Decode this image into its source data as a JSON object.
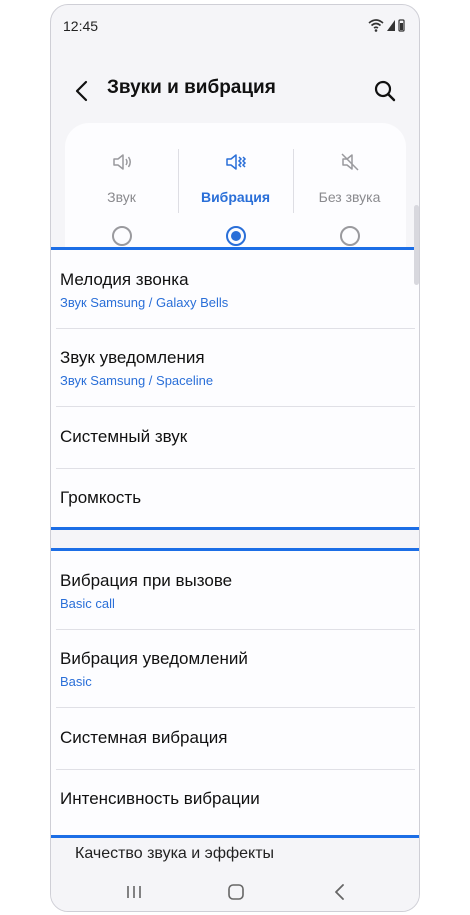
{
  "status_bar": {
    "time": "12:45"
  },
  "header": {
    "title": "Звуки и вибрация"
  },
  "sound_modes": [
    {
      "label": "Звук",
      "icon": "speaker-icon",
      "selected": false
    },
    {
      "label": "Вибрация",
      "icon": "vibrate-icon",
      "selected": true
    },
    {
      "label": "Без звука",
      "icon": "mute-icon",
      "selected": false
    }
  ],
  "sound_group": [
    {
      "title": "Мелодия звонка",
      "subtitle": "Звук Samsung / Galaxy Bells"
    },
    {
      "title": "Звук уведомления",
      "subtitle": "Звук Samsung / Spaceline"
    },
    {
      "title": "Системный звук"
    },
    {
      "title": "Громкость"
    }
  ],
  "vibration_group": [
    {
      "title": "Вибрация при вызове",
      "subtitle": "Basic call"
    },
    {
      "title": "Вибрация уведомлений",
      "subtitle": "Basic"
    },
    {
      "title": "Системная вибрация"
    },
    {
      "title": "Интенсивность вибрации"
    }
  ],
  "tail_item": {
    "title": "Качество звука и эффекты"
  },
  "colors": {
    "accent": "#2a6fd8",
    "highlight_border": "#1c6ee6",
    "background": "#f5f5f8"
  }
}
